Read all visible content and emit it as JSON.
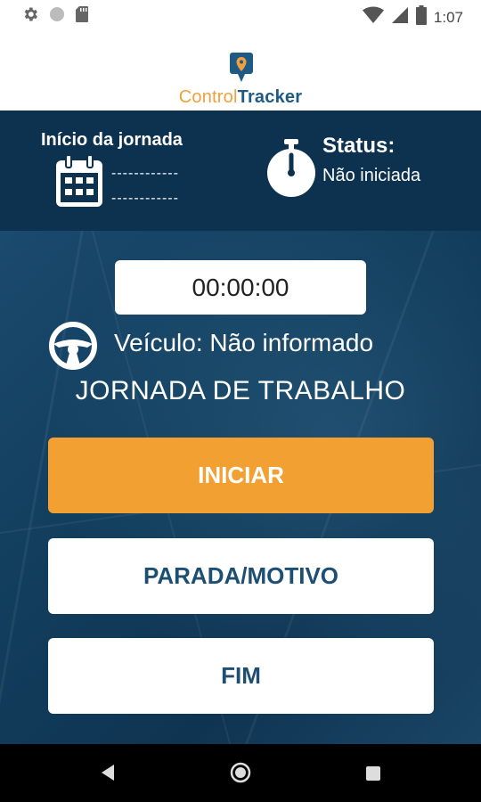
{
  "status_bar": {
    "time": "1:07",
    "icons": [
      "settings-icon",
      "circle-icon",
      "sd-card-icon",
      "wifi-icon",
      "signal-icon",
      "battery-icon"
    ]
  },
  "logo": {
    "word1": "Control",
    "word2": "Tracker",
    "colors": {
      "orange": "#f0a03c",
      "blue": "#1e5a84"
    }
  },
  "info": {
    "inicio_title": "Início da jornada",
    "date_placeholder": "------------",
    "time_placeholder": "------------",
    "status_title": "Status:",
    "status_value": "Não iniciada"
  },
  "main": {
    "timer": "00:00:00",
    "veiculo": "Veículo: Não informado",
    "jornada_title": "JORNADA DE TRABALHO"
  },
  "buttons": {
    "iniciar": "INICIAR",
    "parada": "PARADA/MOTIVO",
    "fim": "FIM"
  },
  "colors": {
    "header_bg": "#0c3250",
    "accent": "#f3a033",
    "button_text": "#1d4e74"
  }
}
